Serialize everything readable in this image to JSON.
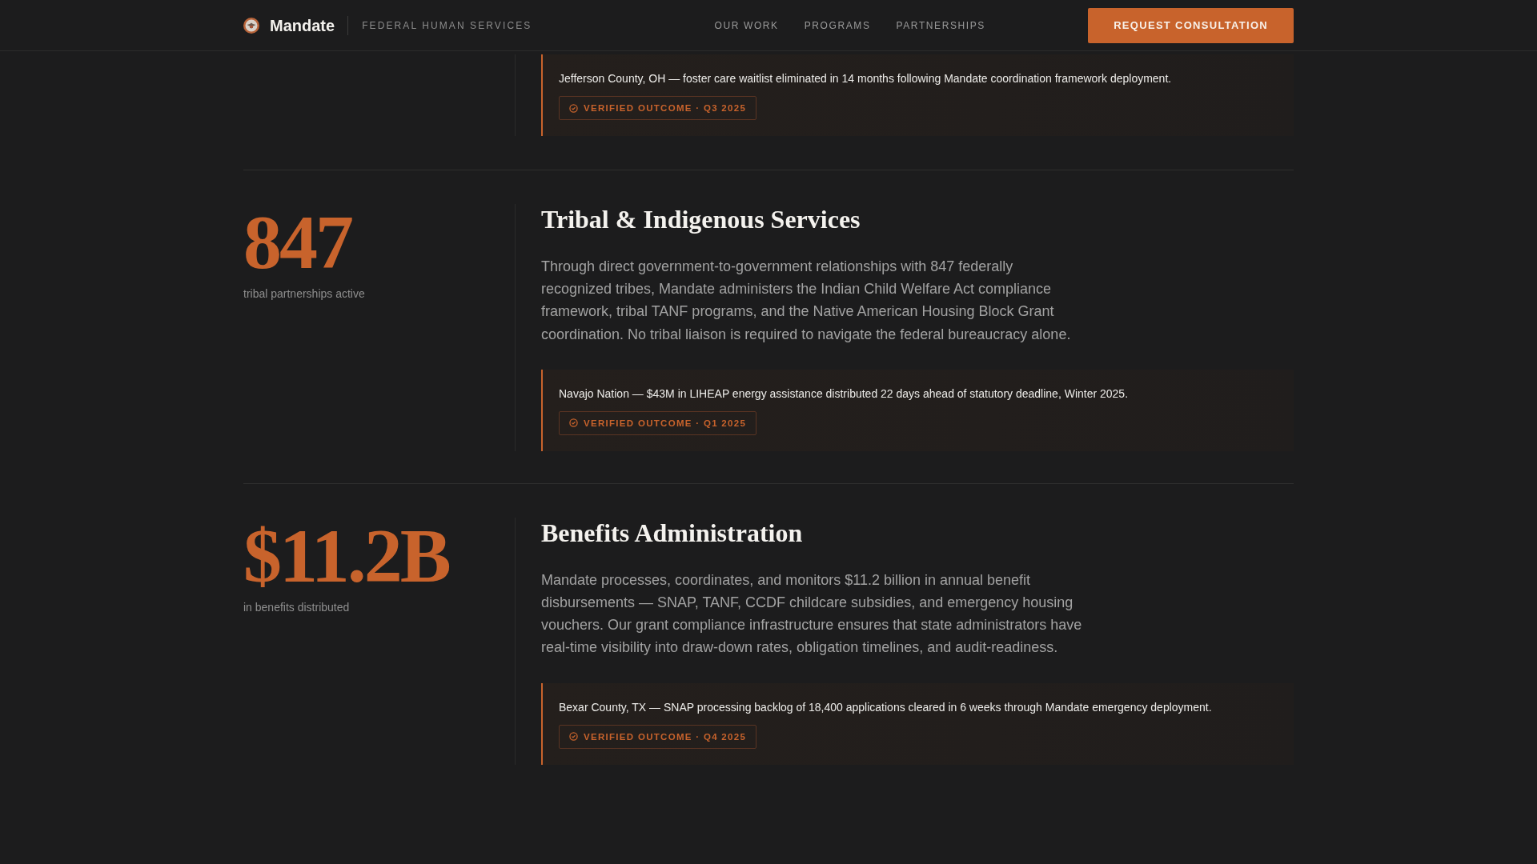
{
  "header": {
    "brand": "Mandate",
    "tagline": "FEDERAL HUMAN SERVICES",
    "nav": [
      "OUR WORK",
      "PROGRAMS",
      "PARTNERSHIPS"
    ],
    "cta": "REQUEST CONSULTATION"
  },
  "sections": [
    {
      "outcome": {
        "text": "Jefferson County, OH — foster care waitlist eliminated in 14 months following Mandate coordination framework deployment.",
        "badge": "VERIFIED OUTCOME · Q3 2025"
      }
    },
    {
      "stat": "847",
      "stat_label": "tribal partnerships active",
      "title": "Tribal & Indigenous Services",
      "body": "Through direct government-to-government relationships with 847 federally recognized tribes, Mandate administers the Indian Child Welfare Act compliance framework, tribal TANF programs, and the Native American Housing Block Grant coordination. No tribal liaison is required to navigate the federal bureaucracy alone.",
      "outcome": {
        "text": "Navajo Nation — $43M in LIHEAP energy assistance distributed 22 days ahead of statutory deadline, Winter 2025.",
        "badge": "VERIFIED OUTCOME · Q1 2025"
      }
    },
    {
      "stat": "$11.2B",
      "stat_label": "in benefits distributed",
      "title": "Benefits Administration",
      "body": "Mandate processes, coordinates, and monitors $11.2 billion in annual benefit disbursements — SNAP, TANF, CCDF childcare subsidies, and emergency housing vouchers. Our grant compliance infrastructure ensures that state administrators have real-time visibility into draw-down rates, obligation timelines, and audit-readiness.",
      "outcome": {
        "text": "Bexar County, TX — SNAP processing backlog of 18,400 applications cleared in 6 weeks through Mandate emergency deployment.",
        "badge": "VERIFIED OUTCOME · Q4 2025"
      }
    }
  ]
}
